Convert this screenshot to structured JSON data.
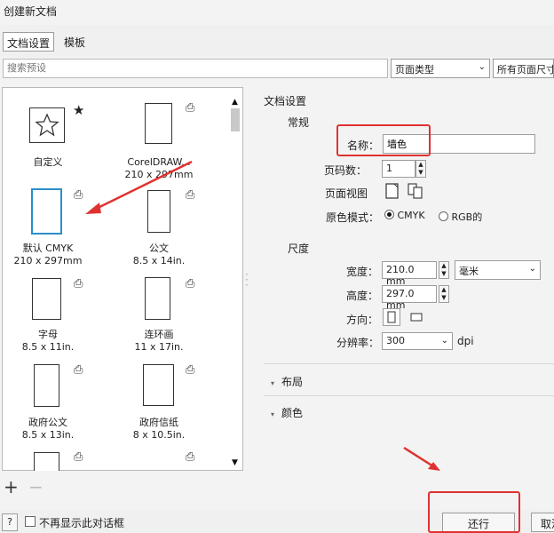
{
  "window": {
    "title": "创建新文档"
  },
  "tabs": [
    {
      "label": "文档设置",
      "active": true
    },
    {
      "label": "模板",
      "active": false
    }
  ],
  "search": {
    "placeholder": "搜索预设"
  },
  "filters": {
    "page_type": "页面类型",
    "page_size": "所有页面尺寸"
  },
  "templates": [
    {
      "name": "自定义",
      "size": "",
      "icon": "star-icon"
    },
    {
      "name": "CorelDRAW...",
      "size": "210 x 297mm",
      "icon": "printer-icon"
    },
    {
      "name": "默认 CMYK",
      "size": "210 x 297mm",
      "icon": "printer-icon",
      "selected": true
    },
    {
      "name": "公文",
      "size": "8.5 x 14in.",
      "icon": "printer-icon"
    },
    {
      "name": "字母",
      "size": "8.5 x 11in.",
      "icon": "printer-icon"
    },
    {
      "name": "连环画",
      "size": "11 x 17in.",
      "icon": "printer-icon"
    },
    {
      "name": "政府公文",
      "size": "8.5 x 13in.",
      "icon": "printer-icon"
    },
    {
      "name": "政府信纸",
      "size": "8 x 10.5in.",
      "icon": "printer-icon"
    },
    {
      "name": "",
      "size": "",
      "icon": "printer-icon"
    },
    {
      "name": "",
      "size": "",
      "icon": "printer-icon"
    }
  ],
  "preset_actions": {
    "add": "+",
    "remove": "−"
  },
  "doc_settings": {
    "heading": "文档设置",
    "general": {
      "heading": "常规",
      "name_label": "名称：",
      "name_value": "墙色",
      "pages_label": "页码数：",
      "pages_value": "1",
      "page_view_label": "页面视图",
      "color_mode_label": "原色模式：",
      "color_modes": [
        "CMYK",
        "RGB的"
      ],
      "selected_color_mode": "CMYK"
    },
    "dimensions": {
      "heading": "尺度",
      "width_label": "宽度：",
      "width_value": "210.0 mm",
      "unit_value": "毫米",
      "height_label": "高度：",
      "height_value": "297.0 mm",
      "orientation_label": "方向：",
      "resolution_label": "分辨率：",
      "resolution_value": "300",
      "resolution_unit": "dpi"
    },
    "sections": [
      "布局",
      "颜色"
    ]
  },
  "footer": {
    "help": "?",
    "dont_show_label": "不再显示此对话框",
    "ok_label": "还行",
    "cancel_label": "取消"
  },
  "annotations": {
    "highlight_color": "#e03131",
    "selection_color": "#2a8ec8"
  }
}
